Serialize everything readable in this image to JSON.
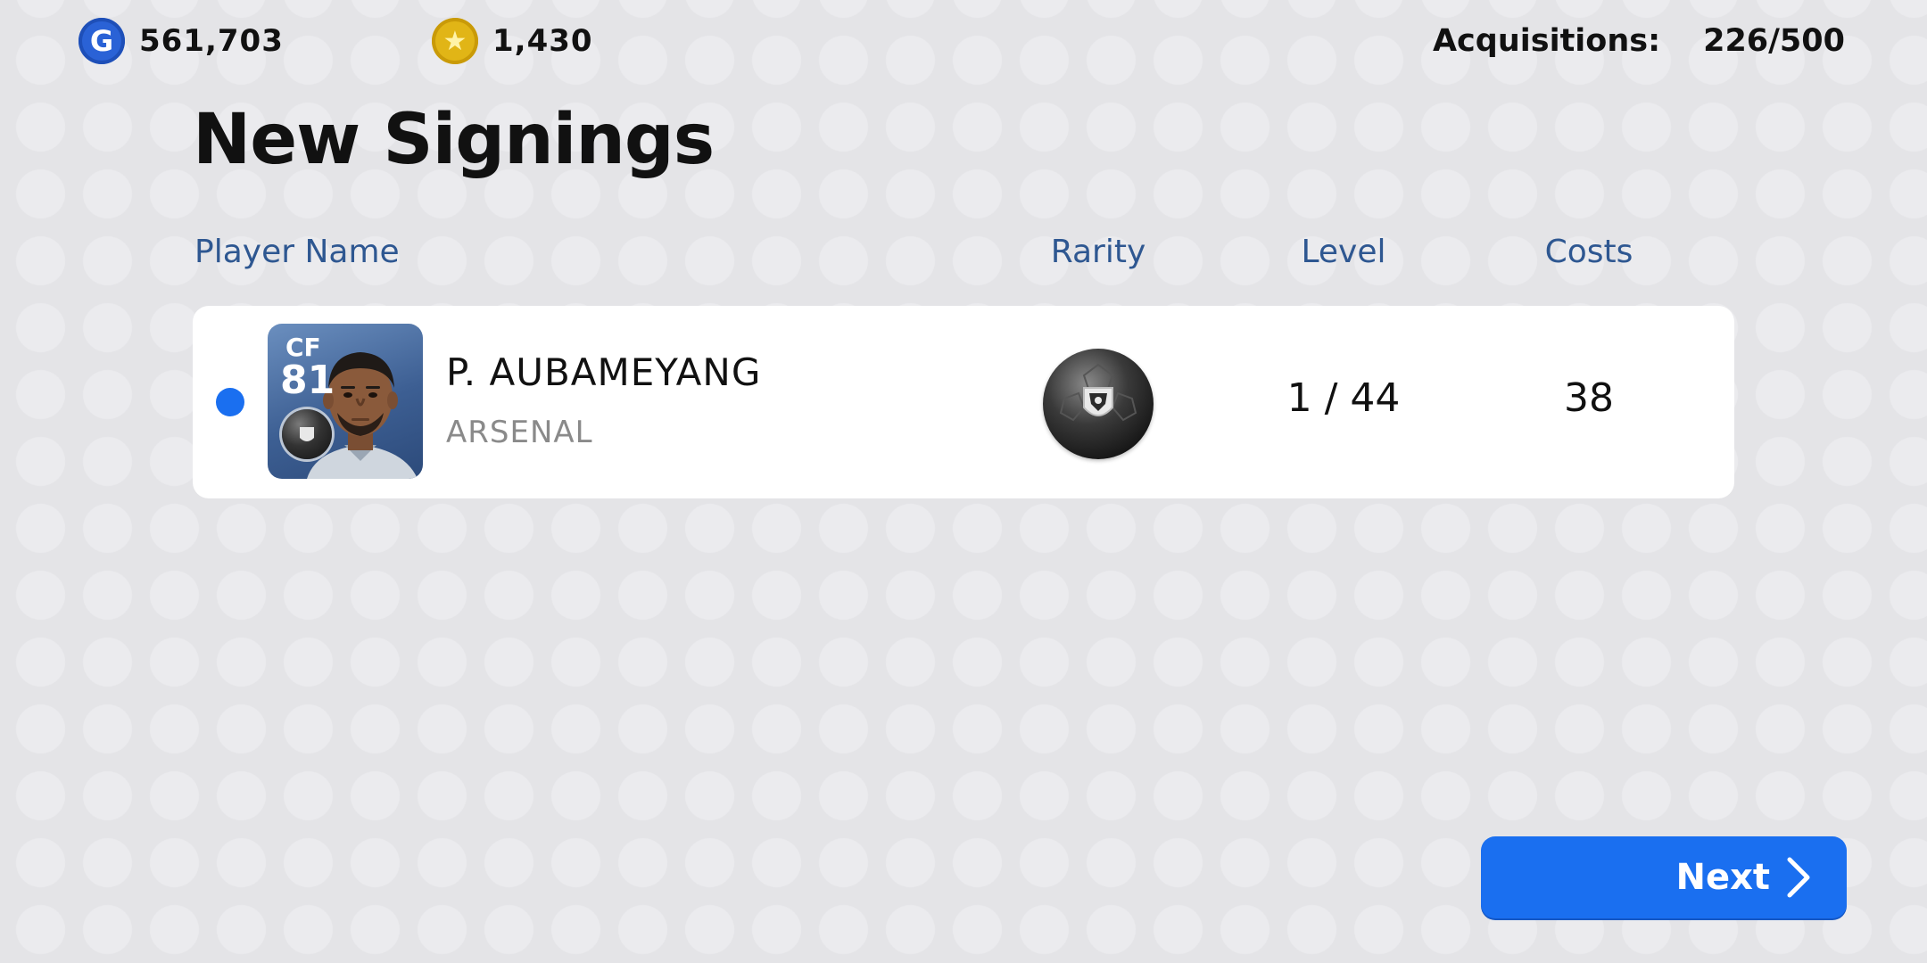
{
  "currencies": {
    "gp": {
      "icon": "gp-coin-icon",
      "glyph": "G",
      "value": "561,703",
      "color": "#2a62d6"
    },
    "coins": {
      "icon": "star-coin-icon",
      "glyph": "★",
      "value": "1,430",
      "color": "#e1b516"
    }
  },
  "acquisitions": {
    "label": "Acquisitions:",
    "value": "226/500"
  },
  "page": {
    "title": "New Signings"
  },
  "table": {
    "headers": {
      "player_name": "Player Name",
      "rarity": "Rarity",
      "level": "Level",
      "costs": "Costs"
    },
    "rows": [
      {
        "position": "CF",
        "rating": "81",
        "name": "P. AUBAMEYANG",
        "club": "ARSENAL",
        "rarity_icon": "black-ball-icon",
        "level": "1 / 44",
        "costs": "38",
        "is_new": true
      }
    ]
  },
  "footer": {
    "next_label": "Next",
    "next_icon": "chevron-right-icon"
  },
  "colors": {
    "accent": "#1a6ff0",
    "header_text": "#2e5791",
    "new_indicator": "#1a6ff0"
  }
}
